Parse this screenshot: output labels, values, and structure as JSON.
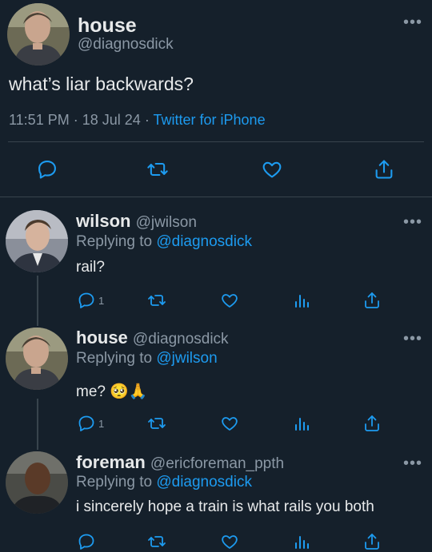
{
  "main_tweet": {
    "name": "house",
    "handle": "@diagnosdick",
    "text": "what’s liar backwards?",
    "time": "11:51 PM",
    "dot1": "·",
    "date": "18 Jul 24",
    "dot2": "·",
    "source": "Twitter for iPhone"
  },
  "replies": [
    {
      "name": "wilson",
      "handle": "@jwilson",
      "replying_prefix": "Replying to",
      "replying_to": "@diagnosdick",
      "text": "rail?",
      "reply_count": "1"
    },
    {
      "name": "house",
      "handle": "@diagnosdick",
      "replying_prefix": "Replying to",
      "replying_to": "@jwilson",
      "text": "me? 🥺🙏",
      "reply_count": "1"
    },
    {
      "name": "foreman",
      "handle": "@ericforeman_ppth",
      "replying_prefix": "Replying to",
      "replying_to": "@diagnosdick",
      "text": "i sincerely hope a train is what rails you both",
      "reply_count": ""
    }
  ],
  "more_glyph": "•••",
  "colors": {
    "background": "#15202b",
    "text": "#e7e9ea",
    "muted": "#8b98a5",
    "link": "#1d9bf0",
    "divider": "#38444d"
  }
}
